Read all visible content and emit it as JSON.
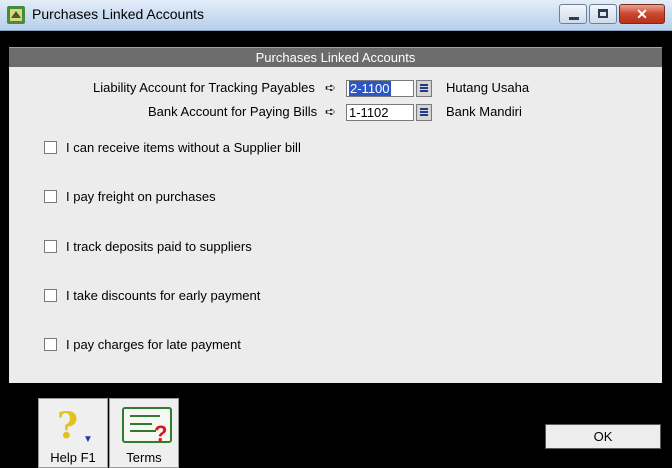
{
  "window": {
    "title": "Purchases Linked Accounts",
    "close_glyph": "✕"
  },
  "panel": {
    "header": "Purchases Linked Accounts"
  },
  "accounts": [
    {
      "label": "Liability Account for Tracking Payables",
      "arrow": "➪",
      "number": "2-1100",
      "name": "Hutang Usaha"
    },
    {
      "label": "Bank Account for Paying Bills",
      "arrow": "➪",
      "number": "1-1102",
      "name": "Bank Mandiri"
    }
  ],
  "options": [
    {
      "label": "I can receive items without a Supplier bill",
      "checked": false
    },
    {
      "label": "I pay freight on purchases",
      "checked": false
    },
    {
      "label": "I track deposits paid to suppliers",
      "checked": false
    },
    {
      "label": "I take discounts for early payment",
      "checked": false
    },
    {
      "label": "I pay charges for late payment",
      "checked": false
    }
  ],
  "buttons": {
    "help": "Help F1",
    "terms": "Terms",
    "ok": "OK",
    "help_glyph": "?",
    "help_arrow": "▼",
    "terms_glyph": "?"
  },
  "colors": {
    "selection": "#2a56c6",
    "header_bg": "#6c6c6c",
    "panel_bg": "#ececec"
  }
}
